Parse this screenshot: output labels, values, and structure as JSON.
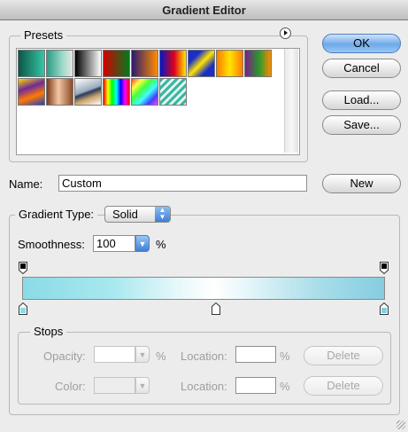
{
  "window": {
    "title": "Gradient Editor"
  },
  "presets": {
    "label": "Presets",
    "swatches": [
      {
        "name": "foreground-to-background",
        "css": "linear-gradient(90deg,#0b5747,#37c4a6)"
      },
      {
        "name": "foreground-to-transparent",
        "css": "linear-gradient(90deg,#2a9c86,#9bd9c8 60%,#e6e6e6)"
      },
      {
        "name": "black-white",
        "css": "linear-gradient(90deg,#000,#fff)"
      },
      {
        "name": "red-green",
        "css": "linear-gradient(90deg,#d40000,#007a1d)"
      },
      {
        "name": "violet-orange",
        "css": "linear-gradient(90deg,#2c1a6e,#ff8c00)"
      },
      {
        "name": "blue-red-yellow",
        "css": "linear-gradient(90deg,#0016c8,#e0001a 55%,#ffe800)"
      },
      {
        "name": "blue-yellow-blue",
        "css": "linear-gradient(135deg,#1a2ec8 25%,#ffe400 50%,#1a2ec8 75%)"
      },
      {
        "name": "orange-yellow-orange",
        "css": "linear-gradient(90deg,#ff7a00,#ffe400 50%,#ff7a00)"
      },
      {
        "name": "violet-green-orange",
        "css": "linear-gradient(90deg,#7b1e8a,#2a9a2a 55%,#ff8a00)"
      },
      {
        "name": "yellow-violet-orange-blue",
        "css": "linear-gradient(160deg,#ffd800,#6e2a9a 35%,#ff7a00 65%,#1f3fc8)"
      },
      {
        "name": "copper",
        "css": "linear-gradient(90deg,#7a3b1a,#f4c7a6 45%,#8a4a26)"
      },
      {
        "name": "chrome",
        "css": "linear-gradient(160deg,#ffffff,#9ab 45%,#2a3a5a 52%,#c9a46a 70%,#fff)"
      },
      {
        "name": "spectrum",
        "css": "linear-gradient(90deg,#ff0000,#ffff00,#00ff00,#00ffff,#0000ff,#ff00ff,#ff0000)"
      },
      {
        "name": "transparent-rainbow",
        "css": "linear-gradient(135deg,#ff4040,#ffff40,#40ff40,#40ffff,#4040ff,#ff40ff)"
      },
      {
        "name": "transparent-stripes",
        "css": "repeating-linear-gradient(135deg,#3ab8a0 0 3px,#e8f5f2 3px 6px)"
      }
    ]
  },
  "buttons": {
    "ok": "OK",
    "cancel": "Cancel",
    "load": "Load...",
    "save": "Save...",
    "new": "New",
    "delete_opacity": "Delete",
    "delete_color": "Delete"
  },
  "name_field": {
    "label": "Name:",
    "value": "Custom"
  },
  "gradient_type": {
    "label": "Gradient Type:",
    "value": "Solid"
  },
  "smoothness": {
    "label": "Smoothness:",
    "value": "100",
    "unit": "%"
  },
  "gradient": {
    "css": "linear-gradient(90deg,#8adbe6 0%,#a9e8ef 25%,#e7f8fa 43%,#ffffff 53%,#e5f6fa 62%,#a8dde9 82%,#86cde0 100%)",
    "color_left": "#8adbe6",
    "color_right": "#86cde0"
  },
  "stops": {
    "label": "Stops",
    "opacity_label": "Opacity:",
    "opacity_value": "",
    "opacity_unit": "%",
    "color_label": "Color:",
    "location_label": "Location:",
    "location_value": "",
    "location_unit": "%",
    "location2_label": "Location:",
    "location2_value": "",
    "location2_unit": "%"
  }
}
